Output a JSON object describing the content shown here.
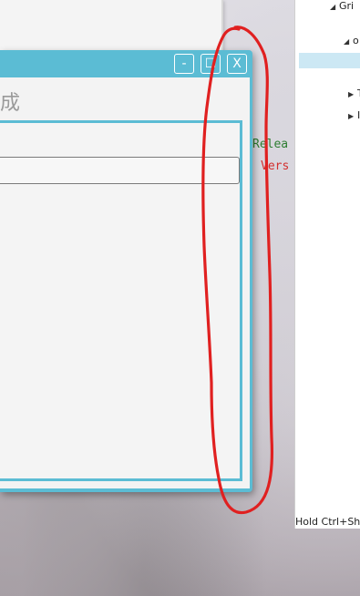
{
  "dialog": {
    "title_fragment": "成",
    "buttons": {
      "minimize": "-",
      "maximize": "☐",
      "close": "X"
    },
    "input_value": ""
  },
  "code_editor": {
    "line1": {
      "text": "Relea",
      "color": "#2e7d32"
    },
    "line2": {
      "text": "Vers",
      "color": "#d32f2f"
    }
  },
  "ide_tree": {
    "items": [
      {
        "label": "Gri",
        "caret": "◢"
      },
      {
        "label": "I",
        "caret": ""
      },
      {
        "label": "o",
        "caret": "◢"
      },
      {
        "label": "",
        "caret": ""
      },
      {
        "label": "T",
        "caret": "▶"
      },
      {
        "label": "I",
        "caret": "▶"
      }
    ]
  },
  "status_hint": "Hold Ctrl+Shi",
  "annotation": {
    "shape": "red-hand-drawn-loop",
    "color": "#e02020"
  },
  "colors": {
    "dialog_accent": "#5bbcd4",
    "selection": "#cce8f4"
  }
}
